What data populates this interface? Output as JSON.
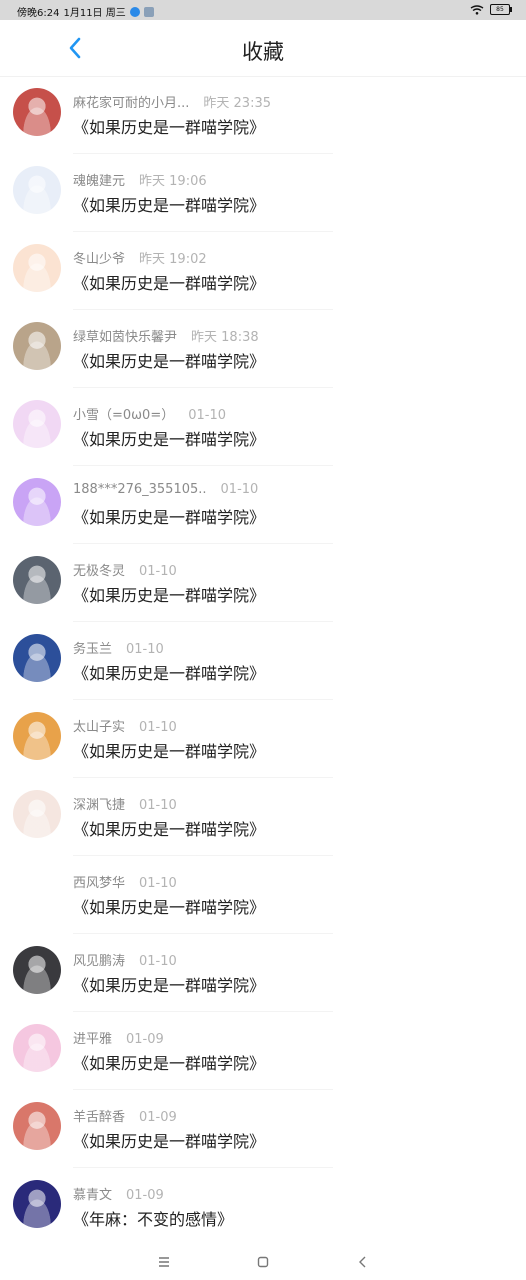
{
  "status_bar": {
    "time_text": "傍晚6:24",
    "date_text": "1月11日 周三",
    "battery_text": "85"
  },
  "header": {
    "title": "收藏"
  },
  "items": [
    {
      "name": "麻花家可耐的小月...",
      "time": "昨天 23:35",
      "title": "《如果历史是一群喵学院》",
      "avatar_color": "#c6504a",
      "avatar_icon": "anime-boy-avatar"
    },
    {
      "name": "魂魄建元",
      "time": "昨天 19:06",
      "title": "《如果历史是一群喵学院》",
      "avatar_color": "#e8eef8",
      "avatar_icon": "cartoon-cat-avatar"
    },
    {
      "name": "冬山少爷",
      "time": "昨天 19:02",
      "title": "《如果历史是一群喵学院》",
      "avatar_color": "#fbe3d2",
      "avatar_icon": "cartoon-giraffe-avatar"
    },
    {
      "name": "绿草如茵快乐馨尹",
      "time": "昨天 18:38",
      "title": "《如果历史是一群喵学院》",
      "avatar_color": "#b9a48a",
      "avatar_icon": "anime-witch-avatar"
    },
    {
      "name": "小雪（=0ω0=）",
      "time": "01-10",
      "title": "《如果历史是一群喵学院》",
      "avatar_color": "#f1d8f4",
      "avatar_icon": "pink-flower-avatar"
    },
    {
      "name": "188***276_355105..",
      "time": "01-10",
      "title": "《如果历史是一群喵学院》",
      "avatar_color": "#c9a4f5",
      "avatar_icon": "chat-bubble-avatar"
    },
    {
      "name": "无极冬灵",
      "time": "01-10",
      "title": "《如果历史是一群喵学院》",
      "avatar_color": "#5b6470",
      "avatar_icon": "car-avatar"
    },
    {
      "name": "务玉兰",
      "time": "01-10",
      "title": "《如果历史是一群喵学院》",
      "avatar_color": "#2c4f9a",
      "avatar_icon": "anime-blue-hair-avatar"
    },
    {
      "name": "太山子实",
      "time": "01-10",
      "title": "《如果历史是一群喵学院》",
      "avatar_color": "#e8a24a",
      "avatar_icon": "autumn-leaves-avatar"
    },
    {
      "name": "深渊飞捷",
      "time": "01-10",
      "title": "《如果历史是一群喵学院》",
      "avatar_color": "#f5e6e0",
      "avatar_icon": "bunny-avatar"
    },
    {
      "name": "西风梦华",
      "time": "01-10",
      "title": "《如果历史是一群喵学院》",
      "avatar_color": "#ffffff",
      "avatar_icon": "blank-avatar"
    },
    {
      "name": "风见鹏涛",
      "time": "01-10",
      "title": "《如果历史是一群喵学院》",
      "avatar_color": "#3a3a3e",
      "avatar_icon": "black-car-avatar"
    },
    {
      "name": "进平雅",
      "time": "01-09",
      "title": "《如果历史是一群喵学院》",
      "avatar_color": "#f5c7e0",
      "avatar_icon": "anime-pink-hair-avatar"
    },
    {
      "name": "羊舌醉香",
      "time": "01-09",
      "title": "《如果历史是一群喵学院》",
      "avatar_color": "#d9776a",
      "avatar_icon": "photo-children-avatar"
    },
    {
      "name": "慕青文",
      "time": "01-09",
      "title": "《年麻：不变的感情》",
      "avatar_color": "#2a2a7a",
      "avatar_icon": "night-lights-avatar"
    }
  ],
  "nav_bar": {
    "icons": [
      "menu-icon",
      "home-square-icon",
      "back-arrow-icon"
    ]
  }
}
